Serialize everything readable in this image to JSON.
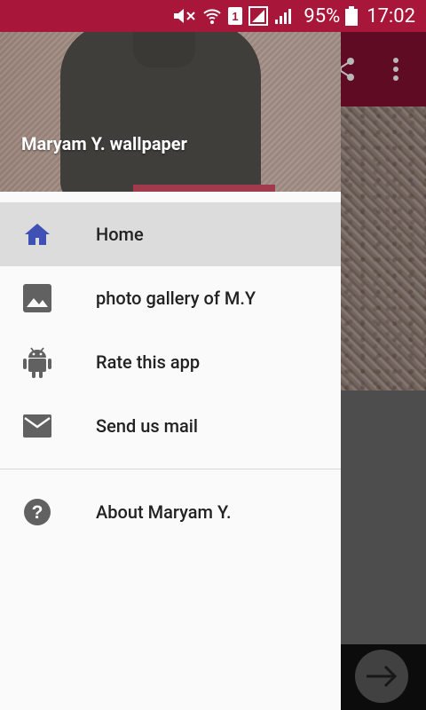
{
  "status_bar": {
    "battery_percent": "95%",
    "time": "17:02",
    "sim_badge": "1"
  },
  "drawer": {
    "title": "Maryam Y. wallpaper",
    "items": [
      {
        "label": "Home",
        "icon": "home-icon",
        "selected": true
      },
      {
        "label": "photo gallery of M.Y",
        "icon": "image-icon"
      },
      {
        "label": "Rate this app",
        "icon": "android-icon"
      },
      {
        "label": "Send us mail",
        "icon": "mail-icon"
      }
    ],
    "secondary_items": [
      {
        "label": "About Maryam Y.",
        "icon": "help-icon"
      }
    ]
  },
  "colors": {
    "status_bar": "#a8163a",
    "toolbar": "#851033",
    "accent_icon": "#3f51b5",
    "icon_gray": "#616161"
  }
}
